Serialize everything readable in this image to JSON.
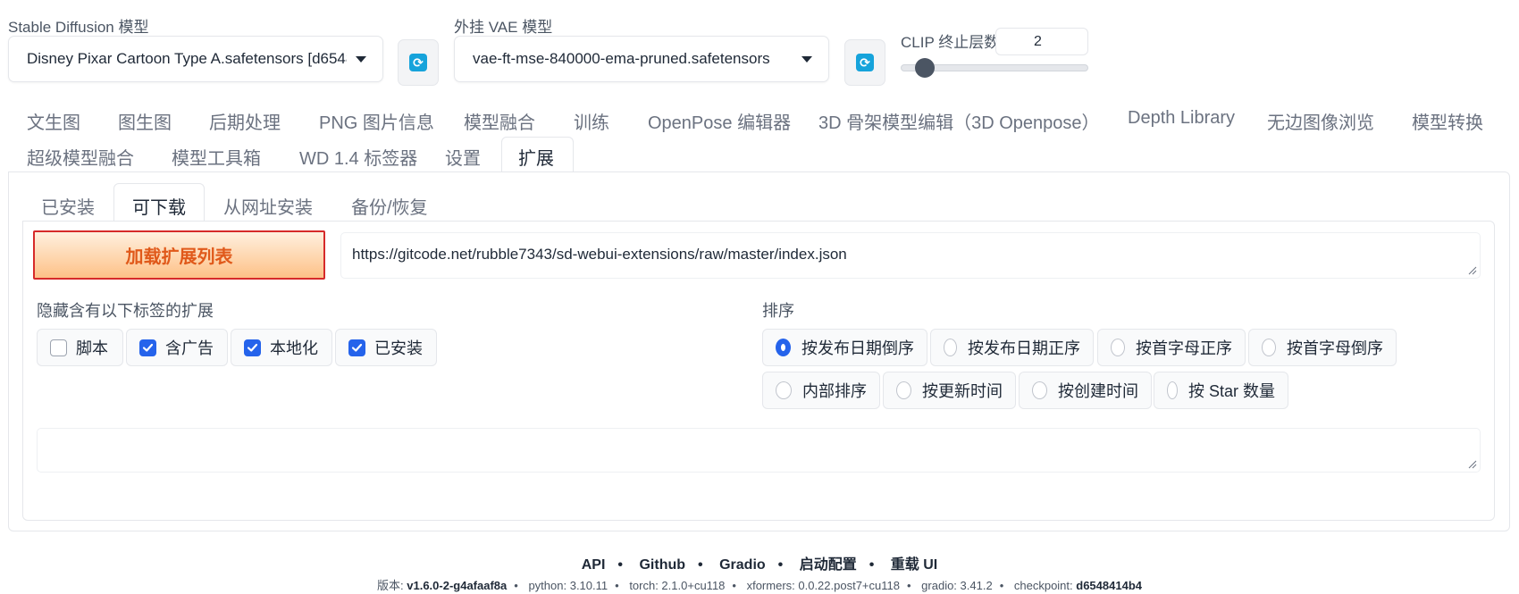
{
  "top": {
    "sd_model_label": "Stable Diffusion 模型",
    "sd_model_value": "Disney Pixar Cartoon Type A.safetensors [d6548",
    "vae_label": "外挂 VAE 模型",
    "vae_value": "vae-ft-mse-840000-ema-pruned.safetensors",
    "clip_label": "CLIP 终止层数",
    "clip_value": "2",
    "clip_slider_fraction": 0.083
  },
  "main_tabs": [
    "文生图",
    "图生图",
    "后期处理",
    "PNG 图片信息",
    "模型融合",
    "训练",
    "OpenPose 编辑器",
    "3D 骨架模型编辑（3D Openpose）",
    "Depth Library",
    "无边图像浏览",
    "模型转换",
    "超级模型融合",
    "模型工具箱",
    "WD 1.4 标签器",
    "设置",
    "扩展"
  ],
  "active_main_tab": "扩展",
  "sub_tabs": [
    "已安装",
    "可下载",
    "从网址安装",
    "备份/恢复"
  ],
  "active_sub_tab": "可下载",
  "load_button": "加载扩展列表",
  "url_value": "https://gitcode.net/rubble7343/sd-webui-extensions/raw/master/index.json",
  "hide_label": "隐藏含有以下标签的扩展",
  "hide_tags": [
    {
      "label": "脚本",
      "checked": false
    },
    {
      "label": "含广告",
      "checked": true
    },
    {
      "label": "本地化",
      "checked": true
    },
    {
      "label": "已安装",
      "checked": true
    }
  ],
  "sort_label": "排序",
  "sort_options": [
    {
      "label": "按发布日期倒序",
      "selected": true
    },
    {
      "label": "按发布日期正序",
      "selected": false
    },
    {
      "label": "按首字母正序",
      "selected": false
    },
    {
      "label": "按首字母倒序",
      "selected": false
    },
    {
      "label": "内部排序",
      "selected": false
    },
    {
      "label": "按更新时间",
      "selected": false
    },
    {
      "label": "按创建时间",
      "selected": false
    },
    {
      "label": "按 Star 数量",
      "selected": false
    }
  ],
  "footer": {
    "links": [
      "API",
      "Github",
      "Gradio",
      "启动配置",
      "重载 UI"
    ],
    "version_label": "版本:",
    "version_value": "v1.6.0-2-g4afaaf8a",
    "python": "python: 3.10.11",
    "torch": "torch: 2.1.0+cu118",
    "xformers": "xformers: 0.0.22.post7+cu118",
    "gradio": "gradio: 3.41.2",
    "checkpoint_label": "checkpoint:",
    "checkpoint_value": "d6548414b4"
  }
}
